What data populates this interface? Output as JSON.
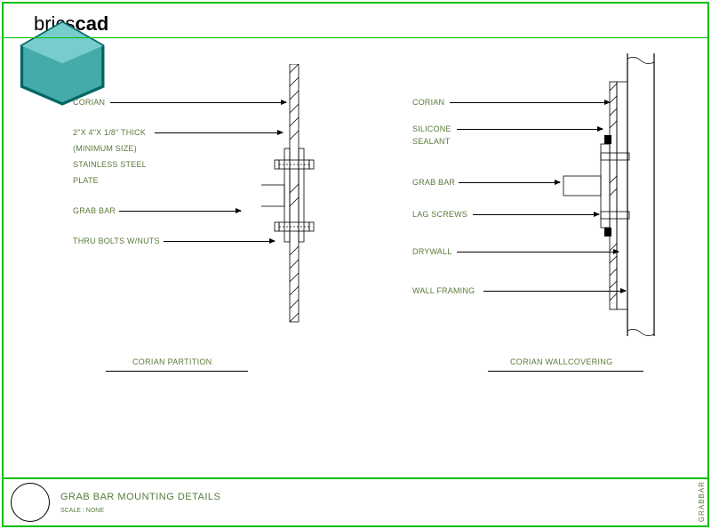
{
  "brand": {
    "prefix": "brics",
    "suffix": "cad"
  },
  "left": {
    "labels": {
      "corian": "CORIAN",
      "thick": "2\"X 4\"X 1/8\" THICK",
      "min": "(MINIMUM SIZE)",
      "steel": "STAINLESS STEEL",
      "plate": "PLATE",
      "grab": "GRAB BAR",
      "bolts": "THRU BOLTS W/NUTS"
    },
    "subtitle": "CORIAN PARTITION"
  },
  "right": {
    "labels": {
      "corian": "CORIAN",
      "silicone": "SILICONE",
      "sealant": "SEALANT",
      "grab": "GRAB BAR",
      "lag": "LAG SCREWS",
      "drywall": "DRYWALL",
      "framing": "WALL FRAMING"
    },
    "subtitle": "CORIAN WALLCOVERING"
  },
  "title": "GRAB BAR MOUNTING DETAILS",
  "scale": "SCALE : NONE",
  "side": "GRABBAR"
}
